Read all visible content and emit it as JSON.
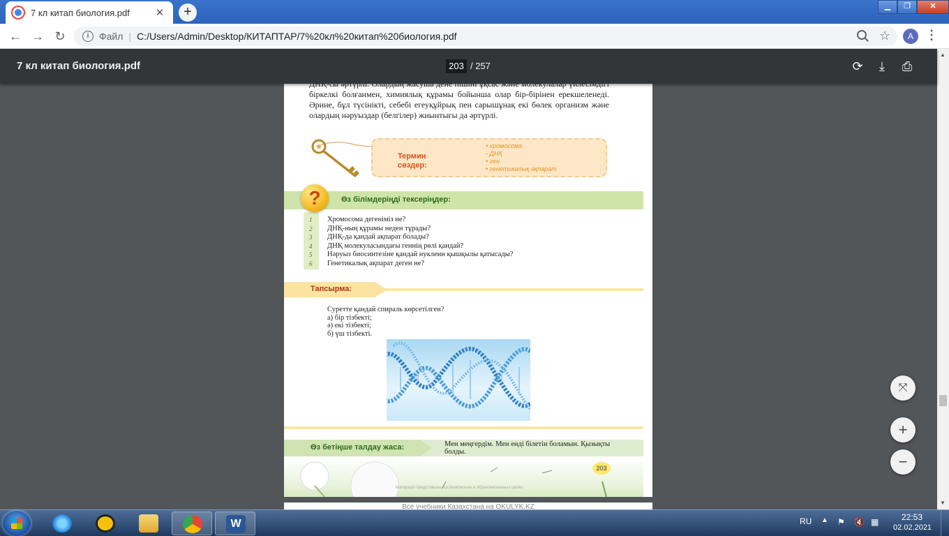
{
  "browser": {
    "tab_title": "7 кл китап биология.pdf",
    "tab_close": "✕",
    "new_tab": "+",
    "window_buttons": {
      "minimize": "▁",
      "maximize": "❐",
      "close": "✕"
    },
    "nav": {
      "back": "←",
      "forward": "→",
      "reload": "↻"
    },
    "address": {
      "info": "i",
      "scheme": "Файл",
      "separator": "|",
      "url": "C:/Users/Admin/Desktop/КИТАПТАР/7%20кл%20китап%20биология.pdf"
    },
    "star": "☆",
    "profile_initial": "A",
    "menu": "⋮"
  },
  "pdf_toolbar": {
    "title": "7 кл китап биология.pdf",
    "current_page": "203",
    "total_pages": "/ 257",
    "rotate": "⟳",
    "download": "⤓",
    "print": "⎙"
  },
  "document": {
    "intro": "ДНҚ-сы әртүрлі. Олардың жасуша дене пішіні ұқсас және молекулалар үйлесімдігі біркелкі болғанмен, химиялық құрамы бойынша олар бір-бірінен ерекшеленеді. Әрине, бұл түсінікті, себебі егеуқұйрық пен сарышұнақ екі бөлек организм және олардың нәруыздар (белгілер) жиынтығы да әртүрлі.",
    "terms": {
      "label_line1": "Термин",
      "label_line2": "сөздер:",
      "items": [
        "• хромосома",
        "- ДНҚ",
        "• ген",
        "• генетикалық ақпарат"
      ]
    },
    "check": {
      "badge": "?",
      "title": "Өз білімдеріңді тексеріңдер:",
      "questions": [
        {
          "n": "1",
          "text": "Хромосома дегеніміз не?"
        },
        {
          "n": "2",
          "text": "ДНҚ-ның құрамы неден тұрады?"
        },
        {
          "n": "3",
          "text": "ДНҚ-да қандай ақпарат болады?"
        },
        {
          "n": "4",
          "text": "ДНҚ молекуласындағы геннің рөлі қандай?"
        },
        {
          "n": "5",
          "text": "Нәруыз биосинтезіне қандай нуклеин қышқылы қатысады?"
        },
        {
          "n": "6",
          "text": "Генетикалық ақпарат деген не?"
        }
      ]
    },
    "task": {
      "title": "Тапсырма:",
      "question": "Суретте қандай спираль көрсетілген?",
      "options": [
        "а) бір тізбекті;",
        "ә) екі тізбекті;",
        "б) үш тізбекті."
      ]
    },
    "self_analysis": {
      "title": "Өз бетіңше талдау жаса:",
      "text": "Мен меңгердім. Мен енді білетін боламын. Қызықты болды."
    },
    "page_number": "203",
    "watermark": "Материал представлен исключительно в образовательных целях",
    "next_page_text": "Все учебники Казахстана на OKULYK.KZ"
  },
  "zoom_controls": {
    "fit": "⤧",
    "zoom_in": "+",
    "zoom_out": "−"
  },
  "taskbar": {
    "language": "RU",
    "tray_up": "▲",
    "time": "22:53",
    "date": "02.02.2021"
  },
  "colors": {
    "tabbar_blue": "#2c64bd",
    "pdf_toolbar": "#323639",
    "viewer_bg": "#525659",
    "term_orange": "#d9531e",
    "section_green": "#2f6a1f"
  }
}
